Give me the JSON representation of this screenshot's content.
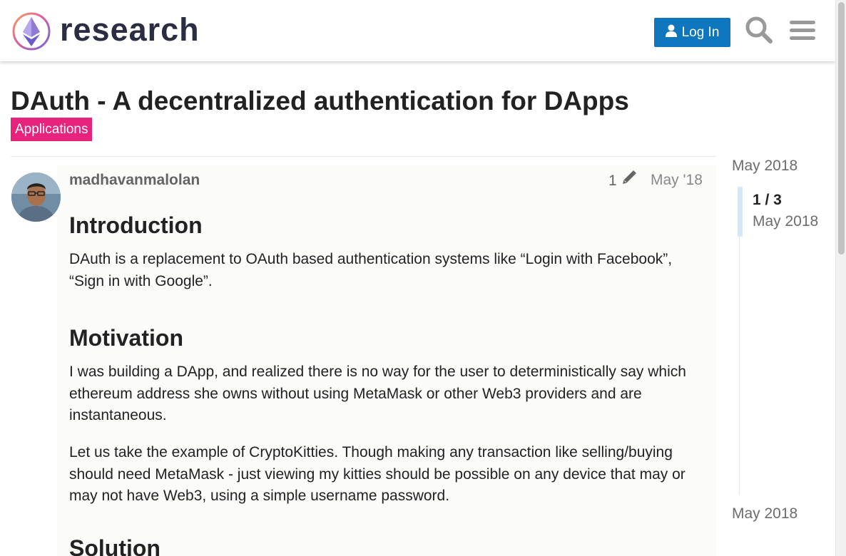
{
  "header": {
    "brand": "research",
    "login_label": "Log In"
  },
  "topic": {
    "title": "DAuth - A decentralized authentication for DApps",
    "category": "Applications",
    "category_color": "#e8237e"
  },
  "post": {
    "username": "madhavanmalolan",
    "edit_count": "1",
    "date": "May '18",
    "sections": {
      "h_introduction": "Introduction",
      "p_intro": "DAuth is a replacement to OAuth based authentication systems like “Login with Facebook”, “Sign in with Google”.",
      "h_motivation": "Motivation",
      "p_motivation_1": "I was building a DApp, and realized there is no way for the user to deterministically say which ethereum address she owns without using MetaMask or other Web3 providers and are instantaneous.",
      "p_motivation_2": "Let us take the example of CryptoKitties. Though making any transaction like selling/buying should need MetaMask - just viewing my kitties should be possible on any device that may or may not have Web3, using a simple username password.",
      "h_solution": "Solution"
    }
  },
  "timeline": {
    "start": "May 2018",
    "position": "1 / 3",
    "current_date": "May 2018",
    "end": "May 2018"
  },
  "colors": {
    "accent": "#0e76bd",
    "timeline_handle": "#d6e8f4"
  },
  "icons": {
    "logo": "ethereum-research-logo",
    "login": "user-icon",
    "search": "search-icon",
    "menu": "hamburger-menu-icon",
    "edit": "pencil-icon"
  }
}
